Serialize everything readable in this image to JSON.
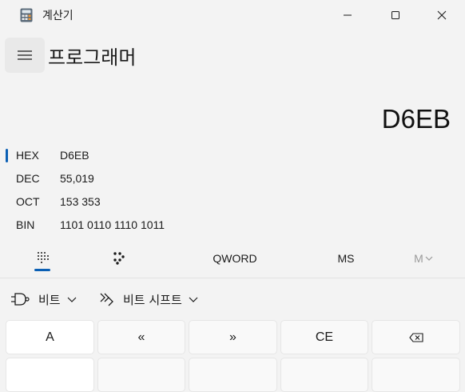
{
  "window": {
    "title": "계산기"
  },
  "header": {
    "mode": "프로그래머"
  },
  "display": {
    "value": "D6EB"
  },
  "radix": [
    {
      "label": "HEX",
      "value": "D6EB",
      "selected": true
    },
    {
      "label": "DEC",
      "value": "55,019",
      "selected": false
    },
    {
      "label": "OCT",
      "value": "153 353",
      "selected": false
    },
    {
      "label": "BIN",
      "value": "1101 0110 1110 1011",
      "selected": false
    }
  ],
  "tabs": {
    "word_size": "QWORD",
    "memory_store": "MS",
    "memory_list": "M"
  },
  "operators": {
    "bitwise": "비트",
    "bit_shift": "비트 시프트"
  },
  "keys": {
    "row1": [
      "A",
      "«",
      "»",
      "CE",
      ""
    ]
  },
  "colors": {
    "accent": "#0a5fb4",
    "background": "#f3f3f3"
  },
  "icons": {
    "app": "calculator-icon",
    "keypad": "keypad-icon",
    "bit_flip": "bit-toggle-icon",
    "bitwise": "logic-gate-icon",
    "bit_shift": "bit-shift-icon",
    "backspace": "backspace-icon"
  }
}
